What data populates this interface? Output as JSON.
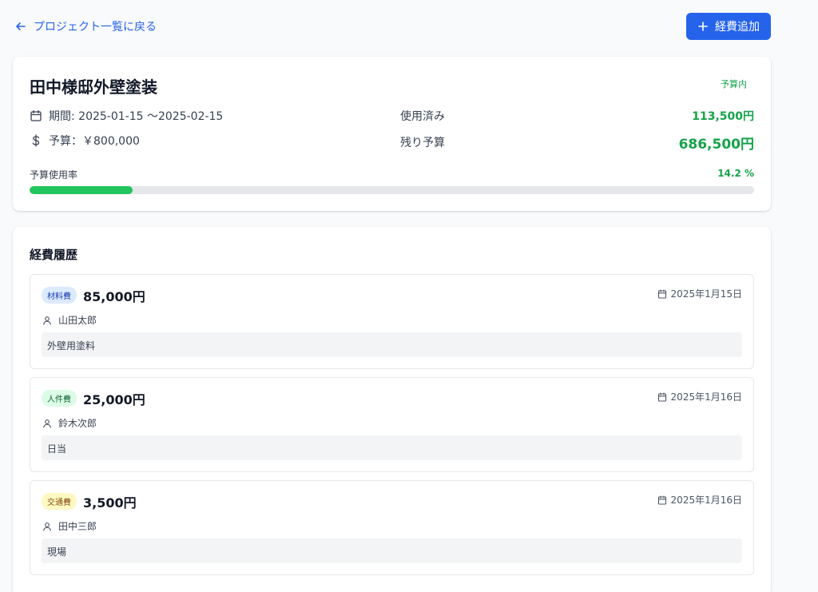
{
  "header": {
    "back_label": "プロジェクト一覧に戻る",
    "add_label": "経費追加"
  },
  "project": {
    "title": "田中様邸外壁塗装",
    "status": "予算内",
    "period_label": "期間: 2025-01-15 〜2025-02-15",
    "budget_label": "予算：￥800,000",
    "used_label": "使用済み",
    "used_value": "113,500円",
    "remaining_label": "残り予算",
    "remaining_value": "686,500円",
    "rate_label": "予算使用率",
    "rate_value": "14.2 %",
    "rate_fraction": 0.142
  },
  "history": {
    "title": "経費履歴",
    "items": [
      {
        "category": "材料費",
        "amount": "85,000円",
        "date": "2025年1月15日",
        "person": "山田太郎",
        "note": "外壁用塗料",
        "badge_bg": "#dbeafe",
        "badge_fg": "#1e40af"
      },
      {
        "category": "人件費",
        "amount": "25,000円",
        "date": "2025年1月16日",
        "person": "鈴木次郎",
        "note": "日当",
        "badge_bg": "#dcfce7",
        "badge_fg": "#166534"
      },
      {
        "category": "交通費",
        "amount": "3,500円",
        "date": "2025年1月16日",
        "person": "田中三郎",
        "note": "現場",
        "badge_bg": "#fef9c3",
        "badge_fg": "#854d0e"
      }
    ]
  },
  "colors": {
    "accent": "#2563eb",
    "success": "#16a34a",
    "progress": "#22c55e"
  }
}
